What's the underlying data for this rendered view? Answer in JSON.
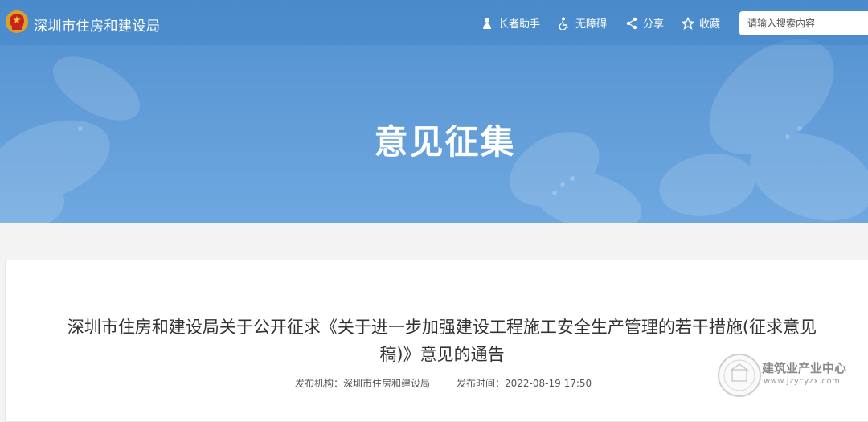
{
  "header": {
    "site_name": "深圳市住房和建设局",
    "tools": [
      {
        "label": "长者助手",
        "icon": "elderly-assist-icon"
      },
      {
        "label": "无障碍",
        "icon": "accessibility-icon"
      },
      {
        "label": "分享",
        "icon": "share-icon"
      },
      {
        "label": "收藏",
        "icon": "star-icon"
      }
    ],
    "search": {
      "placeholder": "请输入搜索内容"
    }
  },
  "banner": {
    "title": "意见征集"
  },
  "article": {
    "title": "深圳市住房和建设局关于公开征求《关于进一步加强建设工程施工安全生产管理的若干措施(征求意见稿)》意见的通告",
    "publisher_label": "发布机构：",
    "publisher": "深圳市住房和建设局",
    "time_label": "发布时间：",
    "time": "2022-08-19 17:50"
  },
  "watermark": {
    "title": "建筑业产业中心",
    "url": "www.jzycyzx.com"
  },
  "colors": {
    "header_bg": "#4f8fcf",
    "banner_text": "#ffffff",
    "title_text": "#333333"
  }
}
